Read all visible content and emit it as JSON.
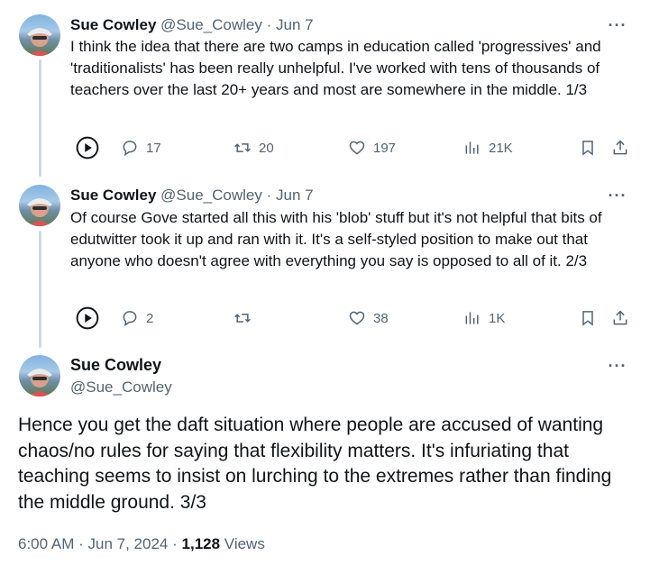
{
  "tweets": [
    {
      "name": "Sue Cowley",
      "handle": "@Sue_Cowley",
      "dot": "·",
      "date": "Jun 7",
      "text": "I think the idea that there are two camps in education called 'progressives' and 'traditionalists' has been really unhelpful. I've worked with tens of thousands of teachers over the last 20+ years and most are somewhere in the middle. 1/3",
      "replies": "17",
      "reposts": "20",
      "likes": "197",
      "views": "21K"
    },
    {
      "name": "Sue Cowley",
      "handle": "@Sue_Cowley",
      "dot": "·",
      "date": "Jun 7",
      "text": "Of course Gove started all this with his 'blob' stuff but it's not helpful that bits of edutwitter took it up and ran with it. It's a self-styled position to make out that anyone who doesn't agree with everything you say is opposed to all of it. 2/3",
      "replies": "2",
      "reposts": "",
      "likes": "38",
      "views": "1K"
    }
  ],
  "main_tweet": {
    "name": "Sue Cowley",
    "handle": "@Sue_Cowley",
    "text": "Hence you get the daft situation where people are accused of wanting chaos/no rules for saying that flexibility matters. It's infuriating that teaching seems to insist on lurching to the extremes rather than finding the middle ground. 3/3",
    "time": "6:00 AM",
    "sep": "·",
    "date": "Jun 7, 2024",
    "views_count": "1,128",
    "views_label": "Views"
  },
  "icons": {
    "more": "more-icon",
    "play": "play-icon",
    "reply": "reply-icon",
    "repost": "repost-icon",
    "like": "heart-icon",
    "views": "analytics-icon",
    "bookmark": "bookmark-icon",
    "share": "share-icon"
  },
  "colors": {
    "text": "#0f1419",
    "secondary": "#536471",
    "thread_line": "#cfd9de"
  }
}
